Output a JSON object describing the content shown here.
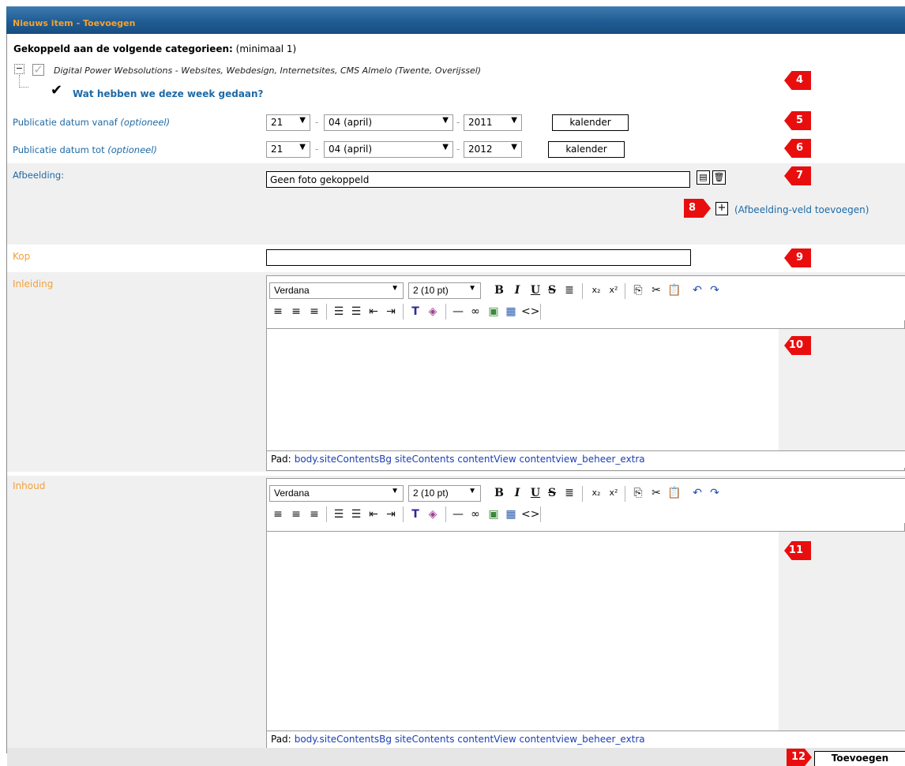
{
  "window": {
    "title": "Nieuws item - Toevoegen"
  },
  "categories": {
    "heading": "Gekoppeld aan de volgende categorieen:",
    "heading_note": "(minimaal 1)",
    "root_label": "Digital Power Websolutions - Websites, Webdesign, Internetsites, CMS Almelo (Twente, Overijssel)",
    "child_label": "Wat hebben we deze week gedaan?"
  },
  "pub_from": {
    "label": "Publicatie datum vanaf",
    "optional": "(optioneel)",
    "day": "21",
    "month": "04 (april)",
    "year": "2011",
    "separator": "-",
    "calendar_label": "kalender"
  },
  "pub_to": {
    "label": "Publicatie datum tot",
    "optional": "(optioneel)",
    "day": "21",
    "month": "04 (april)",
    "year": "2012",
    "separator": "-",
    "calendar_label": "kalender"
  },
  "image": {
    "label": "Afbeelding:",
    "value": "Geen foto gekoppeld",
    "add_symbol": "+",
    "add_label": "(Afbeelding-veld toevoegen)"
  },
  "kop": {
    "label": "Kop",
    "value": ""
  },
  "inleiding": {
    "label": "Inleiding",
    "font": "Verdana",
    "size": "2 (10 pt)",
    "path_label": "Pad:",
    "path_value": "body.siteContentsBg siteContents contentView contentview_beheer_extra"
  },
  "inhoud": {
    "label": "Inhoud",
    "font": "Verdana",
    "size": "2 (10 pt)",
    "path_label": "Pad:",
    "path_value": "body.siteContentsBg siteContents contentView contentview_beheer_extra"
  },
  "markers": [
    "4",
    "5",
    "6",
    "7",
    "8",
    "9",
    "10",
    "11",
    "12"
  ],
  "submit_label": "Toevoegen",
  "colors": {
    "title_bg": "#1f5c93",
    "title_text": "#f4a22e",
    "label_blue": "#1d6aa6",
    "label_orange": "#f2a13a",
    "marker": "#e90e0e"
  }
}
